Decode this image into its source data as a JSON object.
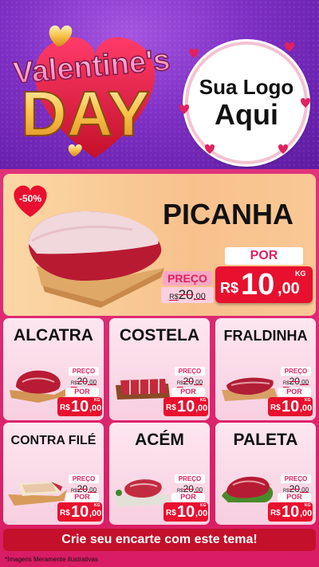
{
  "header": {
    "title_line1": "Valentine's",
    "title_line2": "DAY",
    "logo_line1": "Sua Logo",
    "logo_line2": "Aqui"
  },
  "hero": {
    "name": "PICANHA",
    "discount_badge": "-50%",
    "preco_label": "PREÇO",
    "old_price_prefix": "R$",
    "old_price": "20",
    "old_price_cents": ",00",
    "por_label": "POR",
    "price_prefix": "R$",
    "price": "10",
    "price_cents": ",00",
    "unit": "KG"
  },
  "products": [
    {
      "name": "ALCATRA",
      "preco_label": "PREÇO",
      "old_prefix": "R$",
      "old_price": "20",
      "old_cents": ",00",
      "por_label": "POR",
      "price_prefix": "R$",
      "price": "10",
      "price_cents": ",00",
      "unit": "KG"
    },
    {
      "name": "COSTELA",
      "preco_label": "PREÇO",
      "old_prefix": "R$",
      "old_price": "20",
      "old_cents": ",00",
      "por_label": "POR",
      "price_prefix": "R$",
      "price": "10",
      "price_cents": ",00",
      "unit": "KG"
    },
    {
      "name": "FRALDINHA",
      "preco_label": "PREÇO",
      "old_prefix": "R$",
      "old_price": "20",
      "old_cents": ",00",
      "por_label": "POR",
      "price_prefix": "R$",
      "price": "10",
      "price_cents": ",00",
      "unit": "KG"
    },
    {
      "name": "CONTRA FILÉ",
      "preco_label": "PREÇO",
      "old_prefix": "R$",
      "old_price": "20",
      "old_cents": ",00",
      "por_label": "POR",
      "price_prefix": "R$",
      "price": "10",
      "price_cents": ",00",
      "unit": "KG"
    },
    {
      "name": "ACÉM",
      "preco_label": "PREÇO",
      "old_prefix": "R$",
      "old_price": "20",
      "old_cents": ",00",
      "por_label": "POR",
      "price_prefix": "R$",
      "price": "10",
      "price_cents": ",00",
      "unit": "KG"
    },
    {
      "name": "PALETA",
      "preco_label": "PREÇO",
      "old_prefix": "R$",
      "old_price": "20",
      "old_cents": ",00",
      "por_label": "POR",
      "price_prefix": "R$",
      "price": "10",
      "price_cents": ",00",
      "unit": "KG"
    }
  ],
  "footer": {
    "cta": "Crie seu encarte com este tema!",
    "disclaimer": "*Imagens Meramente Ilustrativas"
  },
  "colors": {
    "header_purple": "#7e2fc4",
    "accent_pink": "#e0225f",
    "price_red": "#e8102e",
    "cta_red": "#c4102a"
  }
}
